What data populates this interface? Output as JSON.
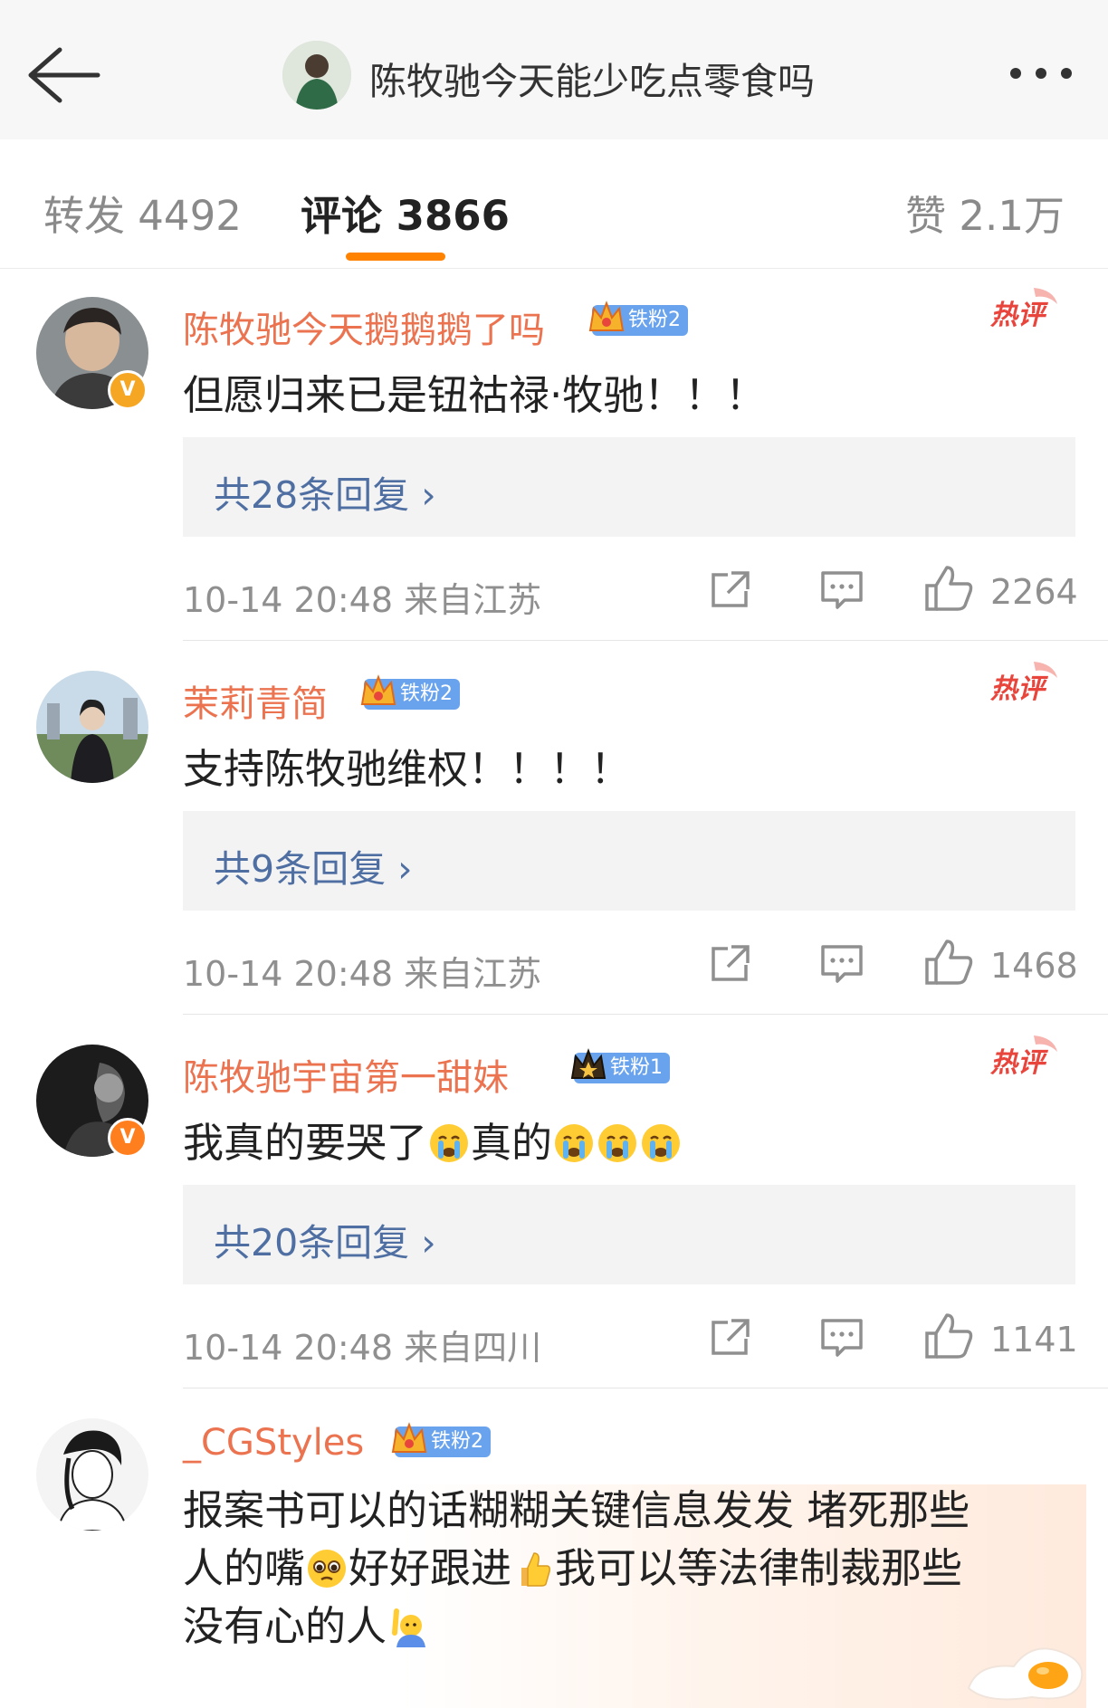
{
  "header": {
    "title": "陈牧驰今天能少吃点零食吗"
  },
  "tabs": {
    "repost": "转发 4492",
    "comments": "评论 3866",
    "likes": "赞 2.1万"
  },
  "hot_label": "热评",
  "comments": [
    {
      "username": "陈牧驰今天鹅鹅鹅了吗",
      "badge": "铁粉2",
      "text": "但愿归来已是钮祜禄·牧驰！！！",
      "replies": "共28条回复 ›",
      "meta": "10-14 20:48 来自江苏",
      "likes": "2264"
    },
    {
      "username": "茉莉青简",
      "badge": "铁粉2",
      "text": "支持陈牧驰维权！！！！",
      "replies": "共9条回复 ›",
      "meta": "10-14 20:48 来自江苏",
      "likes": "1468"
    },
    {
      "username": "陈牧驰宇宙第一甜妹",
      "badge": "铁粉1",
      "text_a": "我真的要哭了",
      "text_b": "真的",
      "replies": "共20条回复 ›",
      "meta": "10-14 20:48 来自四川",
      "likes": "1141"
    },
    {
      "username": "_CGStyles",
      "badge": "铁粉2",
      "line1": "报案书可以的话糊糊关键信息发发 堵死那些",
      "line2a": "人的嘴",
      "line2b": "好好跟进",
      "line2c": "我可以等法律制裁那些",
      "line3": "没有心的人"
    }
  ],
  "colors": {
    "username": "#eb7350",
    "reply_link": "#4f6fa3",
    "accent": "#ff8200",
    "badge": "#6aa3ed",
    "hot": "#e8453c"
  }
}
